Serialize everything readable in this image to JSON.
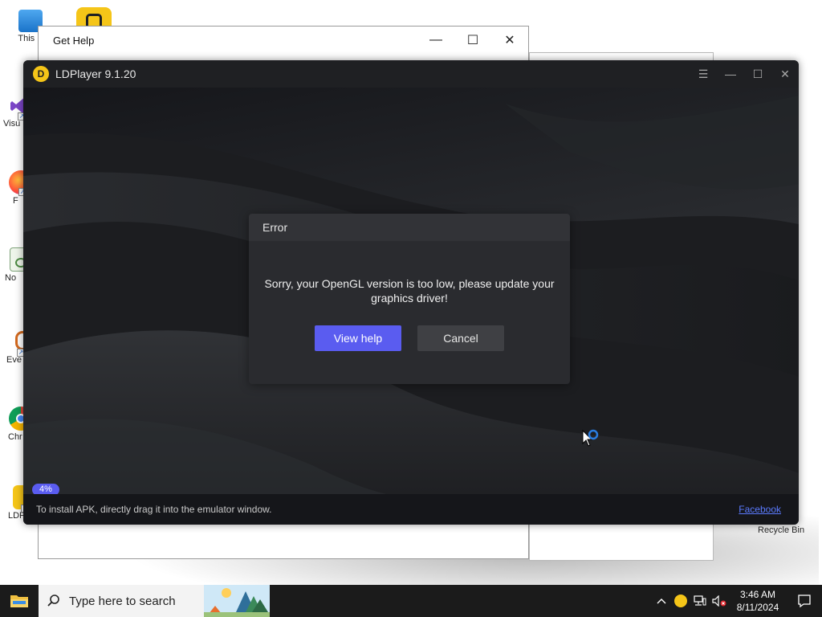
{
  "desktop": {
    "icons": [
      {
        "name": "This PC",
        "label": "This P"
      },
      {
        "name": "Visual Studio",
        "label": "Visu"
      },
      {
        "name": "Firefox",
        "label": "F"
      },
      {
        "name": "Notepad",
        "label": "No"
      },
      {
        "name": "Everything",
        "label": "Eve"
      },
      {
        "name": "Chrome",
        "label": "Chr"
      },
      {
        "name": "LDPlayer",
        "label": "LDPlay"
      }
    ],
    "recycle_bin_label": "Recycle Bin"
  },
  "get_help_window": {
    "title": "Get Help",
    "controls": {
      "minimize": "—",
      "maximize": "☐",
      "close": "✕"
    }
  },
  "ldplayer": {
    "title": "LDPlayer 9.1.20",
    "controls": {
      "menu": "☰",
      "minimize": "—",
      "maximize": "☐",
      "close": "✕"
    },
    "progress_label": "4%",
    "tip": "To install APK, directly drag it into the emulator window.",
    "facebook_link": "Facebook"
  },
  "error_dialog": {
    "title": "Error",
    "message": "Sorry, your OpenGL version is too low, please update your graphics driver!",
    "primary_button": "View help",
    "secondary_button": "Cancel"
  },
  "taskbar": {
    "search_placeholder": "Type here to search",
    "time": "3:46 AM",
    "date": "8/11/2024"
  },
  "colors": {
    "accent": "#5a5cf0",
    "ld_background": "#1c1d20",
    "dialog_background": "#2a2b2f",
    "taskbar": "#1b1b1b",
    "link": "#5b7bff"
  }
}
